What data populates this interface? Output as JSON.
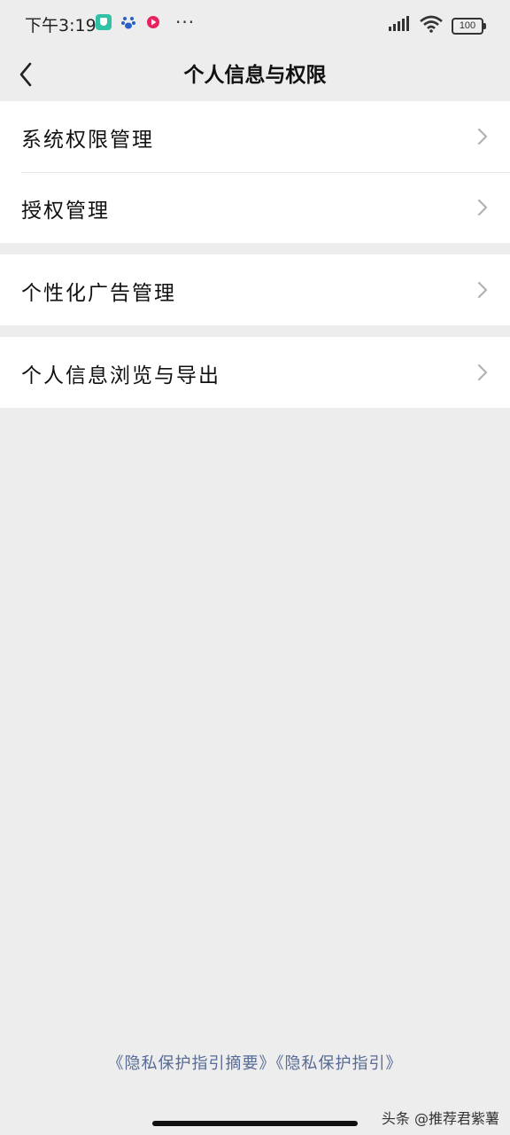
{
  "status_bar": {
    "time": "下午3:19",
    "more": "···",
    "battery": "100",
    "icons": [
      "shield-app-icon",
      "paw-app-icon",
      "video-app-icon",
      "signal-icon",
      "wifi-icon",
      "battery-icon"
    ]
  },
  "nav": {
    "title": "个人信息与权限",
    "back_icon": "chevron-left-icon"
  },
  "groups": [
    {
      "items": [
        {
          "label": "系统权限管理"
        },
        {
          "label": "授权管理"
        }
      ]
    },
    {
      "items": [
        {
          "label": "个性化广告管理"
        }
      ]
    },
    {
      "items": [
        {
          "label": "个人信息浏览与导出"
        }
      ]
    }
  ],
  "footer": {
    "link1": "《隐私保护指引摘要》",
    "link2": "《隐私保护指引》"
  },
  "watermark": "头条 @推荐君紫薯",
  "colors": {
    "background": "#ededed",
    "card": "#ffffff",
    "link": "#576b95",
    "chevron": "#b2b2b2"
  }
}
